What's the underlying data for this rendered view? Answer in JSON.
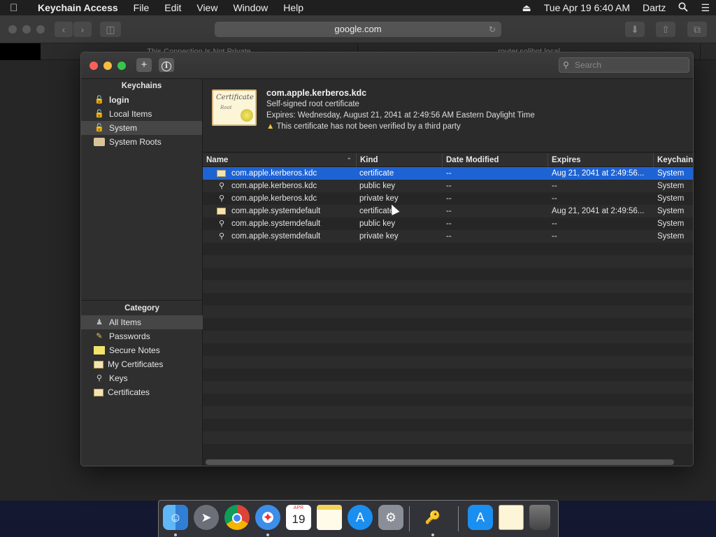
{
  "menubar": {
    "app_name": "Keychain Access",
    "menus": [
      "File",
      "Edit",
      "View",
      "Window",
      "Help"
    ],
    "datetime": "Tue Apr 19  6:40 AM",
    "user": "Dartz"
  },
  "safari": {
    "url": "google.com",
    "tabs": [
      "This Connection Is Not Private",
      "router.solibot.local"
    ]
  },
  "window": {
    "search_placeholder": "Search",
    "add_label": "+",
    "info_label": "i"
  },
  "sidebar": {
    "keychains_header": "Keychains",
    "keychains": [
      {
        "label": "login",
        "icon": "lock-open-icon"
      },
      {
        "label": "Local Items",
        "icon": "lock-open-icon"
      },
      {
        "label": "System",
        "icon": "lock-open-icon"
      },
      {
        "label": "System Roots",
        "icon": "cabinet-icon"
      }
    ],
    "category_header": "Category",
    "categories": [
      {
        "label": "All Items",
        "icon": "people-icon"
      },
      {
        "label": "Passwords",
        "icon": "pencil-icon"
      },
      {
        "label": "Secure Notes",
        "icon": "note-icon"
      },
      {
        "label": "My Certificates",
        "icon": "certificate-icon"
      },
      {
        "label": "Keys",
        "icon": "key-icon"
      },
      {
        "label": "Certificates",
        "icon": "certificate-icon"
      }
    ]
  },
  "detail": {
    "cert_image_text": "Certificate",
    "cert_image_sub": "Root",
    "title": "com.apple.kerberos.kdc",
    "subtitle": "Self-signed root certificate",
    "expires": "Expires: Wednesday, August 21, 2041 at 2:49:56 AM Eastern Daylight Time",
    "warning": "This certificate has not been verified by a third party"
  },
  "table": {
    "columns": [
      "Name",
      "Kind",
      "Date Modified",
      "Expires",
      "Keychain"
    ],
    "rows": [
      {
        "name": "com.apple.kerberos.kdc",
        "kind": "certificate",
        "modified": "--",
        "expires": "Aug 21, 2041 at 2:49:56...",
        "keychain": "System",
        "icon": "certificate-icon"
      },
      {
        "name": "com.apple.kerberos.kdc",
        "kind": "public key",
        "modified": "--",
        "expires": "--",
        "keychain": "System",
        "icon": "key-icon"
      },
      {
        "name": "com.apple.kerberos.kdc",
        "kind": "private key",
        "modified": "--",
        "expires": "--",
        "keychain": "System",
        "icon": "key-icon"
      },
      {
        "name": "com.apple.systemdefault",
        "kind": "certificate",
        "modified": "--",
        "expires": "Aug 21, 2041 at 2:49:56...",
        "keychain": "System",
        "icon": "certificate-icon"
      },
      {
        "name": "com.apple.systemdefault",
        "kind": "public key",
        "modified": "--",
        "expires": "--",
        "keychain": "System",
        "icon": "key-icon"
      },
      {
        "name": "com.apple.systemdefault",
        "kind": "private key",
        "modified": "--",
        "expires": "--",
        "keychain": "System",
        "icon": "key-icon"
      }
    ]
  },
  "dock": {
    "calendar_month": "APR",
    "calendar_day": "19",
    "apps": [
      "finder-icon",
      "launchpad-icon",
      "chrome-icon",
      "safari-icon",
      "calendar-icon",
      "notes-icon",
      "app-store-icon",
      "system-preferences-icon",
      "keychain-access-icon",
      "applications-folder-icon",
      "certificate-document-icon",
      "trash-icon"
    ]
  },
  "colors": {
    "selection": "#1e63d3",
    "close": "#fc605c",
    "minimize": "#fdbc40",
    "zoom": "#34c84a"
  }
}
